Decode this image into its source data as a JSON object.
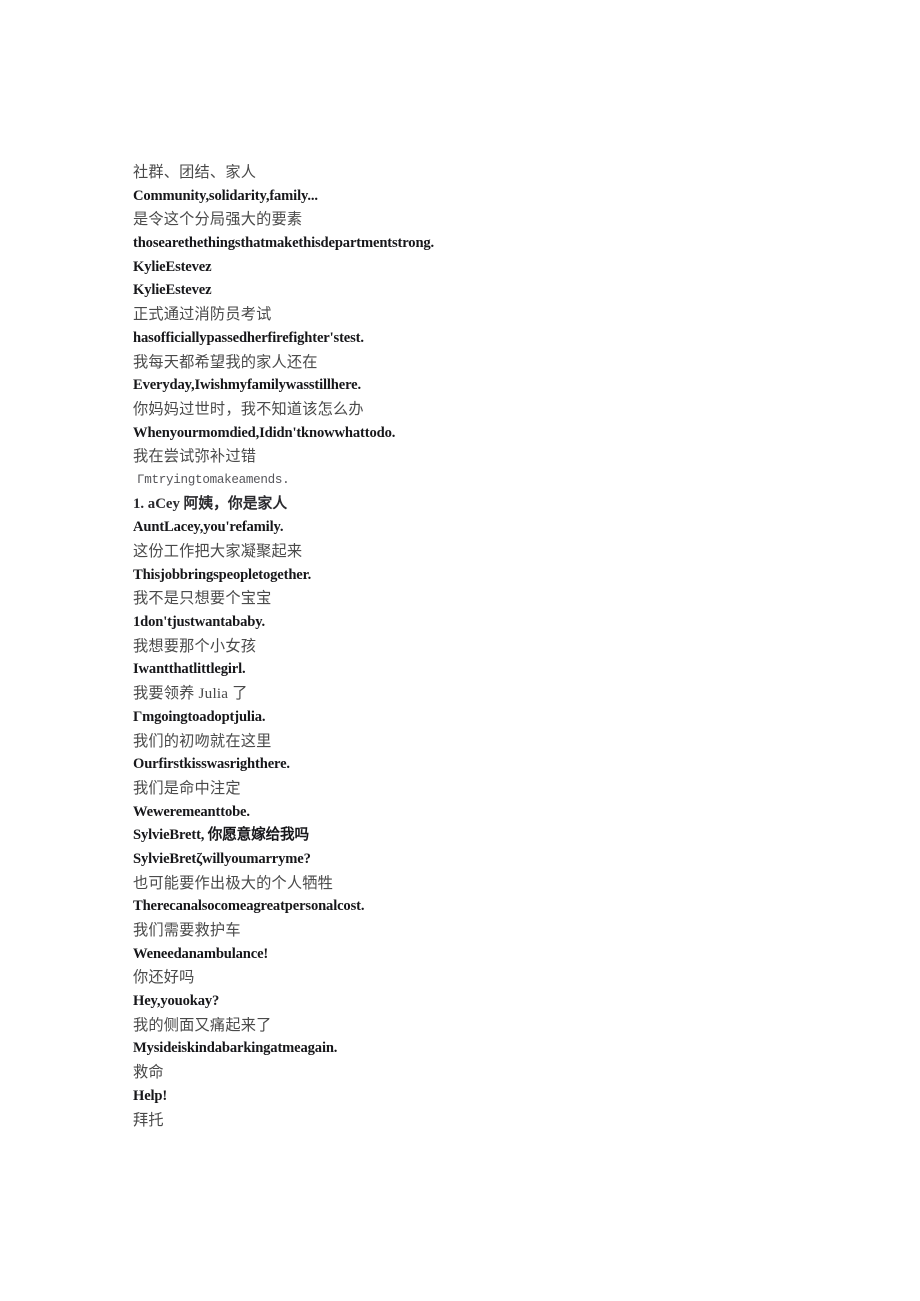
{
  "document": {
    "background_color": "#ffffff",
    "text_color_chinese": "#4a4a4a",
    "text_color_english": "#17171a",
    "lines": [
      {
        "text": "社群、团结、家人",
        "style": "zh"
      },
      {
        "text": "Community,solidarity,family...",
        "style": "en"
      },
      {
        "text": "是令这个分局强大的要素",
        "style": "zh"
      },
      {
        "text": "thosearethethingsthatmakethisdepartmentstrong.",
        "style": "en"
      },
      {
        "text": "KylieEstevez",
        "style": "en"
      },
      {
        "text": "KylieEstevez",
        "style": "en"
      },
      {
        "text": "正式通过消防员考试",
        "style": "zh"
      },
      {
        "text": "hasofficiallypassedherfirefighter'stest.",
        "style": "en"
      },
      {
        "text": "我每天都希望我的家人还在",
        "style": "zh"
      },
      {
        "text": "Everyday,Iwishmyfamilywasstillhere.",
        "style": "en"
      },
      {
        "text": "你妈妈过世时，我不知道该怎么办",
        "style": "zh"
      },
      {
        "text": "Whenyourmomdied,Ididn'tknowwhattodo.",
        "style": "en"
      },
      {
        "text": "我在尝试弥补过错",
        "style": "zh"
      },
      {
        "text": "Γmtryingtomakeamends.",
        "style": "mono"
      },
      {
        "text": "1. aCey 阿姨，你是家人",
        "style": "mixed"
      },
      {
        "text": "AuntLacey,you'refamily.",
        "style": "en"
      },
      {
        "text": "这份工作把大家凝聚起来",
        "style": "zh"
      },
      {
        "text": "Thisjobbringspeopletogether.",
        "style": "en"
      },
      {
        "text": "我不是只想要个宝宝",
        "style": "zh"
      },
      {
        "text": "1don'tjustwantababy.",
        "style": "en"
      },
      {
        "text": "我想要那个小女孩",
        "style": "zh"
      },
      {
        "text": "Iwantthatlittlegirl.",
        "style": "en"
      },
      {
        "text": "我要领养 Julia 了",
        "style": "zh"
      },
      {
        "text": "Γmgoingtoadoptjulia.",
        "style": "en"
      },
      {
        "text": "我们的初吻就在这里",
        "style": "zh"
      },
      {
        "text": "Ourfirstkisswasrighthere.",
        "style": "en"
      },
      {
        "text": "我们是命中注定",
        "style": "zh"
      },
      {
        "text": "Weweremeanttobe.",
        "style": "en"
      },
      {
        "text": "SylvieBrett, 你愿意嫁给我吗",
        "style": "en"
      },
      {
        "text": "SylvieBretζwillyoumarryme?",
        "style": "en"
      },
      {
        "text": "也可能要作出极大的个人牺牲",
        "style": "zh"
      },
      {
        "text": "Therecanalsocomeagreatpersonalcost.",
        "style": "en"
      },
      {
        "text": "我们需要救护车",
        "style": "zh"
      },
      {
        "text": "Weneedanambulance!",
        "style": "en"
      },
      {
        "text": "你还好吗",
        "style": "zh"
      },
      {
        "text": "Hey,youokay?",
        "style": "en"
      },
      {
        "text": "我的侧面又痛起来了",
        "style": "zh"
      },
      {
        "text": "Mysideiskindabarkingatmeagain.",
        "style": "en"
      },
      {
        "text": "救命",
        "style": "zh"
      },
      {
        "text": "Help!",
        "style": "en"
      },
      {
        "text": "拜托",
        "style": "zh"
      }
    ]
  }
}
